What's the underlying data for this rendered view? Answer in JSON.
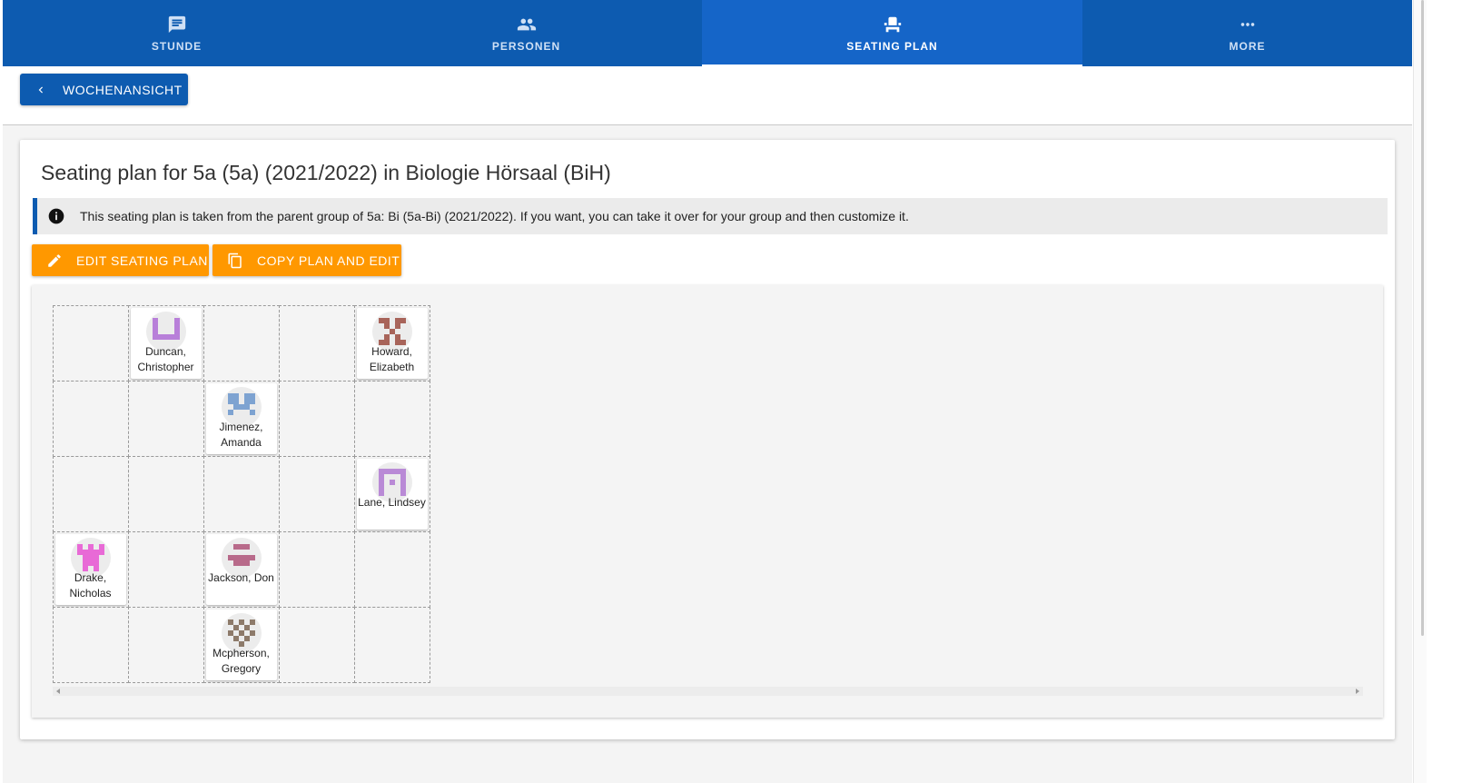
{
  "tabs": [
    {
      "label": "STUNDE",
      "icon": "chat-icon"
    },
    {
      "label": "PERSONEN",
      "icon": "people-icon"
    },
    {
      "label": "SEATING PLAN",
      "icon": "seat-icon",
      "active": true
    },
    {
      "label": "MORE",
      "icon": "more-icon"
    }
  ],
  "toolbar": {
    "back_label": "WOCHENANSICHT"
  },
  "card": {
    "title": "Seating plan for 5a (5a) (2021/2022) in Biologie Hörsaal (BiH)",
    "info": "This seating plan is taken from the parent group of 5a: Bi (5a-Bi) (2021/2022). If you want, you can take it over for your group and then customize it.",
    "edit_label": "EDIT SEATING PLAN",
    "copy_label": "COPY PLAN AND EDIT"
  },
  "seating": {
    "rows": 5,
    "cols": 5,
    "seats": [
      {
        "row": 0,
        "col": 1,
        "name": "Duncan,\nChristopher",
        "color": "#b87fd9"
      },
      {
        "row": 0,
        "col": 4,
        "name": "Howard,\nElizabeth",
        "color": "#a8645a"
      },
      {
        "row": 1,
        "col": 2,
        "name": "Jimenez,\nAmanda",
        "color": "#7ea3d1"
      },
      {
        "row": 2,
        "col": 4,
        "name": "Lane, Lindsey",
        "color": "#b98ad6"
      },
      {
        "row": 3,
        "col": 0,
        "name": "Drake,\nNicholas",
        "color": "#e86ad6"
      },
      {
        "row": 3,
        "col": 2,
        "name": "Jackson, Don",
        "color": "#b86a8a"
      },
      {
        "row": 4,
        "col": 2,
        "name": "Mcpherson,\nGregory",
        "color": "#8d7a6a"
      }
    ]
  },
  "colors": {
    "primary": "#0d5bb0",
    "accent": "#ff9800"
  }
}
